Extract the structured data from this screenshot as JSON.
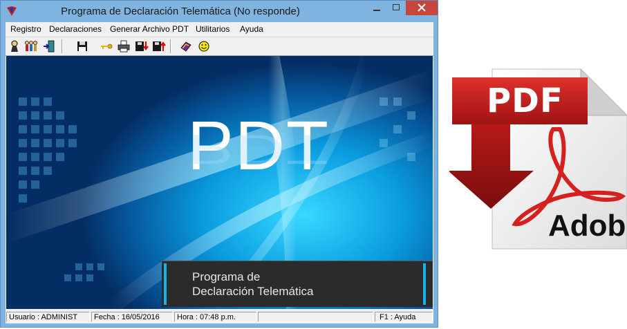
{
  "window": {
    "title": "Programa de Declaración Telemática (No responde)"
  },
  "menu": {
    "items": [
      "Registro",
      "Declaraciones",
      "Generar Archivo PDT",
      "Utilitarios",
      "Ayuda"
    ]
  },
  "toolbar": {
    "icons": [
      "user-icon",
      "users-icon",
      "exit-door-icon",
      "save-disk-icon",
      "key-icon",
      "printer-icon",
      "disk-down-icon",
      "disk-up-icon",
      "book-icon",
      "smiley-icon"
    ]
  },
  "splash": {
    "title": "PDT",
    "reflection": "PDT",
    "banner_line1": "Programa de",
    "banner_line2": "Declaración Telemática"
  },
  "status": {
    "user": "Usuario : ADMINIST",
    "date": "Fecha : 16/05/2016",
    "time": "Hora : 07:48 p.m.",
    "help": "F1 : Ayuda"
  },
  "pdf_logo": {
    "label": "PDF",
    "brand": "Adobe",
    "colors": {
      "red": "#c8201f",
      "dark_red": "#8e1313",
      "page": "#f4f4f4"
    }
  }
}
